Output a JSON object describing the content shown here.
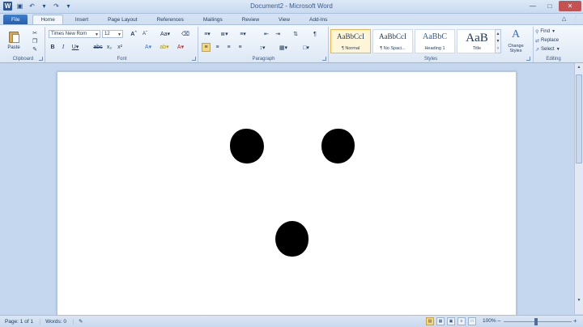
{
  "title_bar": {
    "title": "Document2 - Microsoft Word",
    "logo": "W"
  },
  "tabs": [
    {
      "label": "File"
    },
    {
      "label": "Home"
    },
    {
      "label": "Insert"
    },
    {
      "label": "Page Layout"
    },
    {
      "label": "References"
    },
    {
      "label": "Mailings"
    },
    {
      "label": "Review"
    },
    {
      "label": "View"
    },
    {
      "label": "Add-Ins"
    }
  ],
  "ribbon": {
    "clipboard": {
      "paste_label": "Paste",
      "group_label": "Clipboard"
    },
    "font": {
      "font_name": "Times New Rom",
      "font_size": "12",
      "group_label": "Font"
    },
    "paragraph": {
      "group_label": "Paragraph"
    },
    "styles": {
      "items": [
        {
          "sample": "AaBbCcI",
          "name": "¶ Normal"
        },
        {
          "sample": "AaBbCcI",
          "name": "¶ No Spaci..."
        },
        {
          "sample": "AaBbC",
          "name": "Heading 1"
        },
        {
          "sample": "AaB",
          "name": "Title"
        }
      ],
      "change_styles_label": "Change Styles",
      "group_label": "Styles"
    },
    "editing": {
      "find_label": "Find",
      "replace_label": "Replace",
      "select_label": "Select",
      "group_label": "Editing"
    }
  },
  "status_bar": {
    "page": "Page: 1 of 1",
    "words": "Words: 0",
    "zoom": "100%"
  },
  "colors": {
    "file_tab": "#2a5ea8",
    "accent": "#e8b84c",
    "background": "#c5d7ee"
  }
}
